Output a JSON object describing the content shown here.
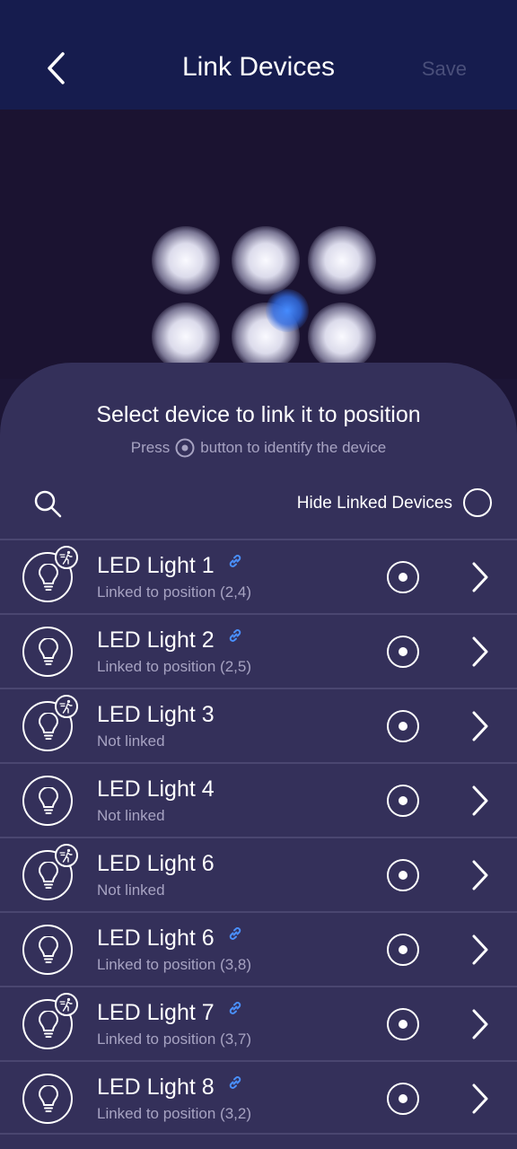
{
  "header": {
    "title": "Link Devices",
    "save_label": "Save",
    "back_icon": "chevron-left-icon"
  },
  "sheet": {
    "title": "Select device to link it to position",
    "hint_before": "Press",
    "hint_after": "button to identify the device",
    "hide_linked_label": "Hide Linked Devices"
  },
  "devices": [
    {
      "name": "LED Light 1",
      "status": "Linked to position (2,4)",
      "linked": true,
      "motion_badge": true
    },
    {
      "name": "LED Light 2",
      "status": "Linked to position (2,5)",
      "linked": true,
      "motion_badge": false
    },
    {
      "name": "LED Light 3",
      "status": "Not linked",
      "linked": false,
      "motion_badge": true
    },
    {
      "name": "LED Light 4",
      "status": "Not linked",
      "linked": false,
      "motion_badge": false
    },
    {
      "name": "LED Light 6",
      "status": "Not linked",
      "linked": false,
      "motion_badge": true
    },
    {
      "name": "LED Light 6",
      "status": "Linked to position (3,8)",
      "linked": true,
      "motion_badge": false
    },
    {
      "name": "LED Light 7",
      "status": "Linked to position (3,7)",
      "linked": true,
      "motion_badge": true
    },
    {
      "name": "LED Light 8",
      "status": "Linked to position (3,2)",
      "linked": true,
      "motion_badge": false
    }
  ],
  "colors": {
    "header_bg": "#161c4e",
    "sheet_bg": "#34305a",
    "accent_link": "#4a90ff",
    "save_disabled": "#4a4f7a"
  }
}
